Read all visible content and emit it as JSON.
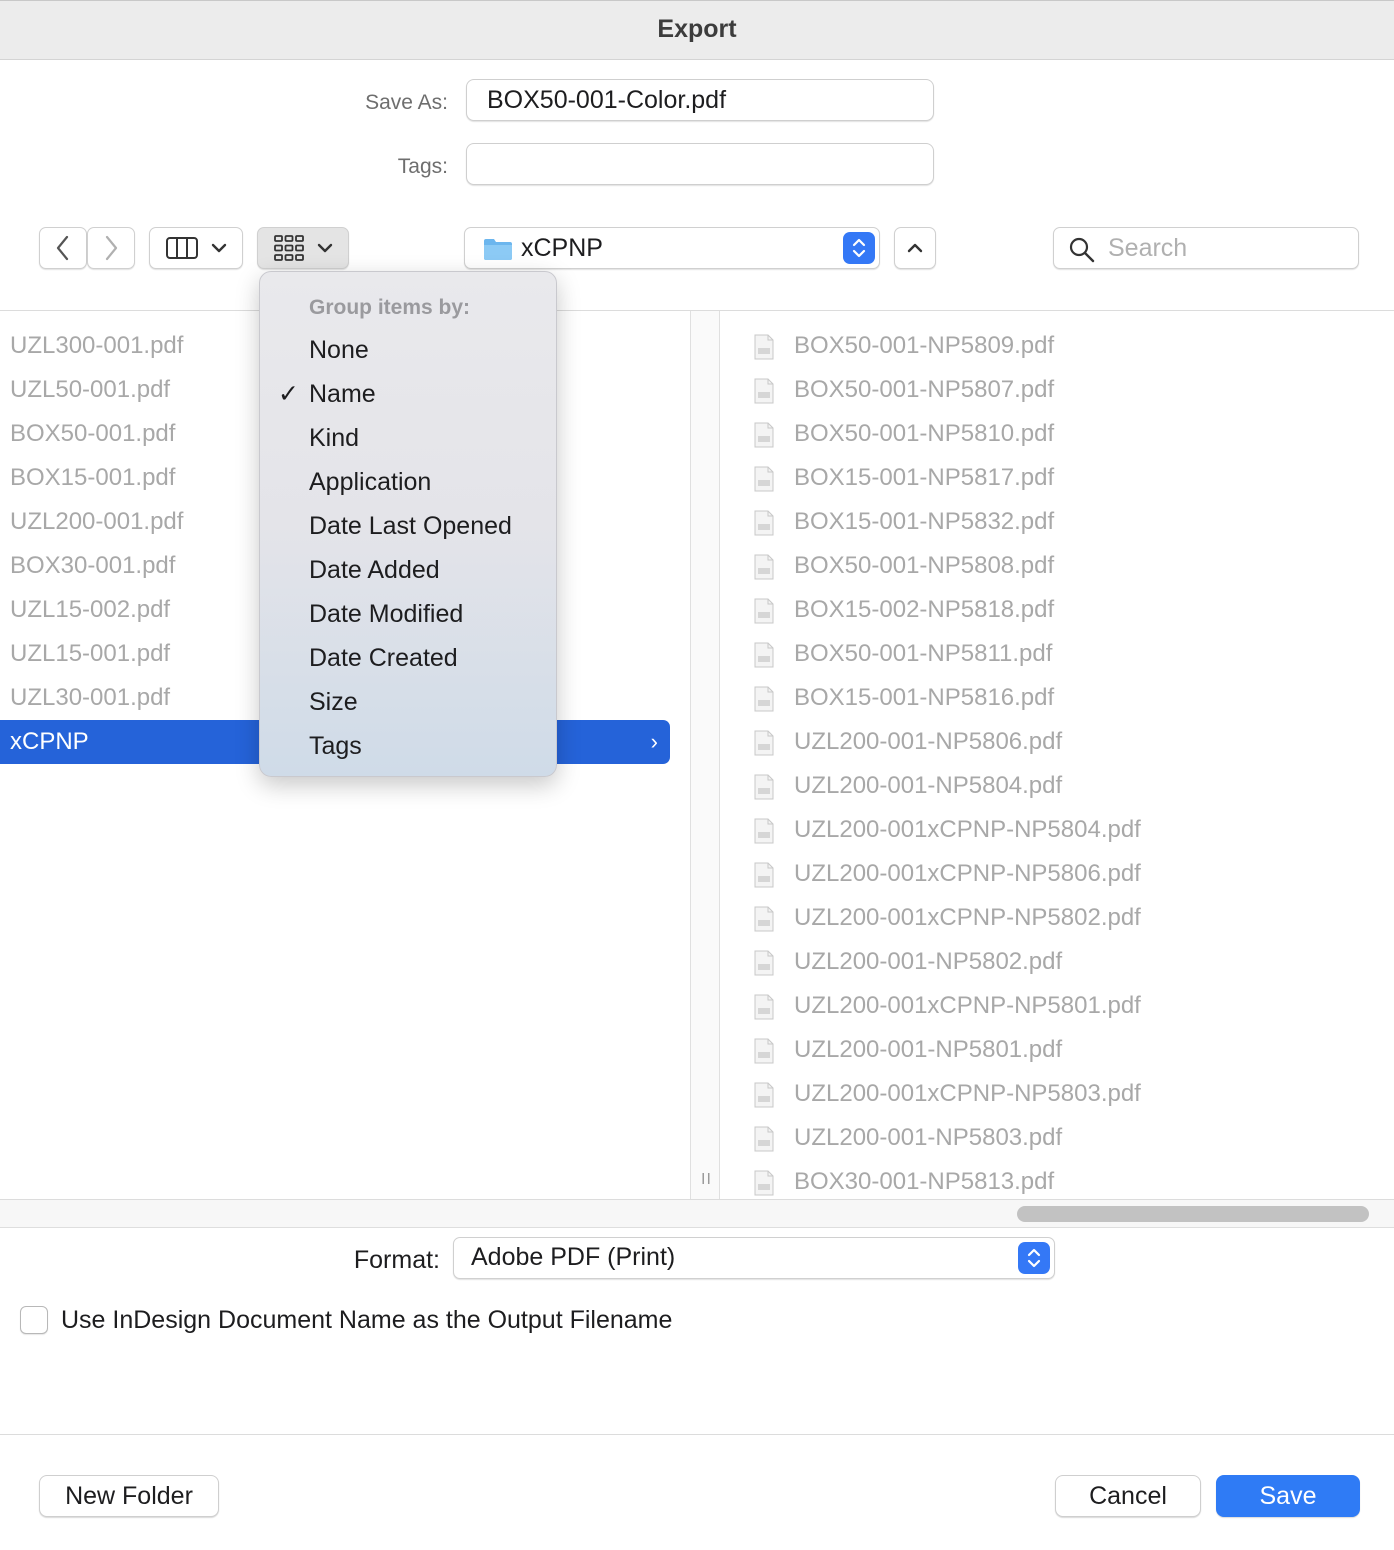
{
  "window": {
    "title": "Export"
  },
  "save_as": {
    "label": "Save As:",
    "value": "BOX50-001-Color.pdf"
  },
  "tags": {
    "label": "Tags:",
    "value": ""
  },
  "toolbar": {
    "path": "xCPNP",
    "search_placeholder": "Search"
  },
  "group_menu": {
    "header": "Group items by:",
    "items": [
      {
        "label": "None",
        "checked": false
      },
      {
        "label": "Name",
        "checked": true
      },
      {
        "label": "Kind",
        "checked": false
      },
      {
        "label": "Application",
        "checked": false
      },
      {
        "label": "Date Last Opened",
        "checked": false
      },
      {
        "label": "Date Added",
        "checked": false
      },
      {
        "label": "Date Modified",
        "checked": false
      },
      {
        "label": "Date Created",
        "checked": false
      },
      {
        "label": "Size",
        "checked": false
      },
      {
        "label": "Tags",
        "checked": false
      }
    ],
    "check_glyph": "✓"
  },
  "column1": [
    {
      "name": "UZL300-001.pdf"
    },
    {
      "name": "UZL50-001.pdf"
    },
    {
      "name": "BOX50-001.pdf"
    },
    {
      "name": "BOX15-001.pdf"
    },
    {
      "name": "UZL200-001.pdf"
    },
    {
      "name": "BOX30-001.pdf"
    },
    {
      "name": "UZL15-002.pdf"
    },
    {
      "name": "UZL15-001.pdf"
    },
    {
      "name": "UZL30-001.pdf"
    },
    {
      "name": "xCPNP",
      "selected": true
    }
  ],
  "column2": [
    "BOX50-001-NP5809.pdf",
    "BOX50-001-NP5807.pdf",
    "BOX50-001-NP5810.pdf",
    "BOX15-001-NP5817.pdf",
    "BOX15-001-NP5832.pdf",
    "BOX50-001-NP5808.pdf",
    "BOX15-002-NP5818.pdf",
    "BOX50-001-NP5811.pdf",
    "BOX15-001-NP5816.pdf",
    "UZL200-001-NP5806.pdf",
    "UZL200-001-NP5804.pdf",
    "UZL200-001xCPNP-NP5804.pdf",
    "UZL200-001xCPNP-NP5806.pdf",
    "UZL200-001xCPNP-NP5802.pdf",
    "UZL200-001-NP5802.pdf",
    "UZL200-001xCPNP-NP5801.pdf",
    "UZL200-001-NP5801.pdf",
    "UZL200-001xCPNP-NP5803.pdf",
    "UZL200-001-NP5803.pdf",
    "BOX30-001-NP5813.pdf"
  ],
  "format": {
    "label": "Format:",
    "value": "Adobe PDF (Print)"
  },
  "use_doc_name": {
    "label": "Use InDesign Document Name as the Output Filename",
    "checked": false
  },
  "buttons": {
    "new_folder": "New Folder",
    "cancel": "Cancel",
    "save": "Save"
  },
  "colors": {
    "accent": "#2f7bf5",
    "selection": "#2563d9"
  }
}
